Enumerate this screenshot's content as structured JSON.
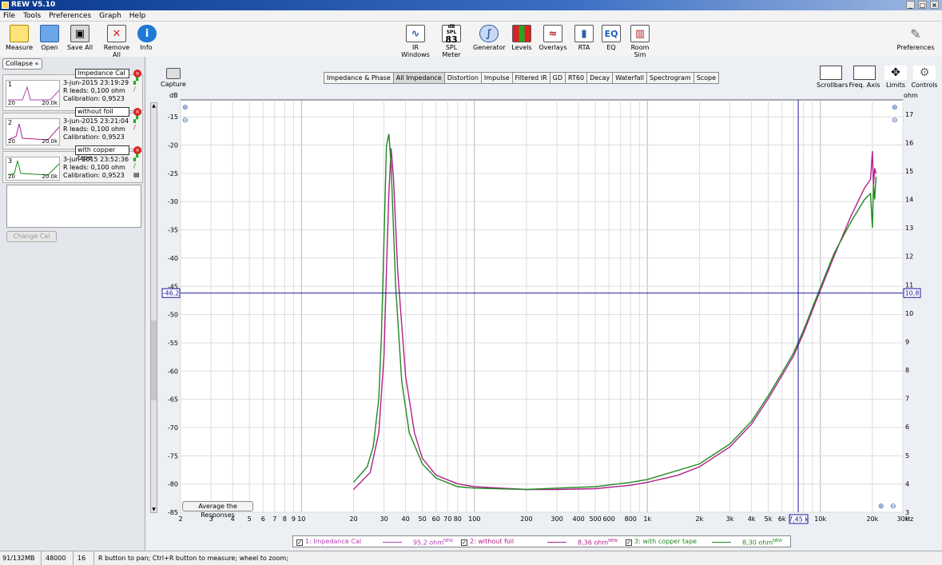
{
  "window": {
    "title": "REW V5.10"
  },
  "menu": [
    "File",
    "Tools",
    "Preferences",
    "Graph",
    "Help"
  ],
  "toolbar": {
    "left": [
      "Measure",
      "Open",
      "Save All",
      "Remove All",
      "Info"
    ],
    "center": [
      "IR Windows",
      "SPL Meter",
      "Generator",
      "Levels",
      "Overlays",
      "RTA",
      "EQ",
      "Room Sim"
    ],
    "spl_meter": {
      "unit": "dB SPL",
      "value": "83"
    },
    "eq_icon_text": "EQ",
    "right": "Preferences"
  },
  "panel": {
    "collapse": "Collapse",
    "measurements": [
      {
        "num": "1",
        "name": "Impedance Cal",
        "date": "3-jun-2015 23:19:29",
        "rleads": "R leads: 0,100 ohm",
        "cal": "Calibration: 0,9523",
        "ax_min": "20",
        "ax_max": "20.0k",
        "color": "#b040b0"
      },
      {
        "num": "2",
        "name": "without foil",
        "date": "3-jun-2015 23:21:04",
        "rleads": "R leads: 0,100 ohm",
        "cal": "Calibration: 0,9523",
        "ax_min": "20",
        "ax_max": "20.0k",
        "color": "#b0208a"
      },
      {
        "num": "3",
        "name": "with copper tape",
        "date": "3-jun-2015 23:52:36",
        "rleads": "R leads: 0,100 ohm",
        "cal": "Calibration: 0,9523",
        "ax_min": "20",
        "ax_max": "20.0k",
        "color": "#208a20"
      }
    ],
    "change_cal": "Change Cal"
  },
  "graph_tools": {
    "capture": "Capture",
    "right": [
      "Scrollbars",
      "Freq. Axis",
      "Limits",
      "Controls"
    ]
  },
  "tabs": [
    "Impedance & Phase",
    "All Impedance",
    "Distortion",
    "Impulse",
    "Filtered IR",
    "GD",
    "RT60",
    "Decay",
    "Waterfall",
    "Spectrogram",
    "Scope"
  ],
  "active_tab": "All Impedance",
  "average_button": "Average the Responses",
  "chart_data": {
    "type": "line",
    "xscale": "log",
    "xlim": [
      2,
      30000
    ],
    "ylim_left": [
      -85,
      -12
    ],
    "ylim_right": [
      3,
      17.5
    ],
    "left_unit": "dB",
    "right_unit": "ohm",
    "x_unit": "Hz",
    "x_ticks": [
      2,
      3,
      4,
      5,
      6,
      7,
      8,
      9,
      10,
      20,
      30,
      40,
      50,
      60,
      70,
      80,
      100,
      200,
      300,
      400,
      500,
      600,
      800,
      1000,
      2000,
      3000,
      4000,
      5000,
      6000,
      7000,
      10000,
      20000,
      30000
    ],
    "x_tick_labels": [
      "2",
      "3",
      "4",
      "5",
      "6",
      "7",
      "8",
      "9",
      "10",
      "20",
      "30",
      "40",
      "50",
      "60",
      "70",
      "80",
      "100",
      "200",
      "300",
      "400",
      "500",
      "600",
      "800",
      "1k",
      "2k",
      "3k",
      "4k",
      "5k",
      "6k",
      "7k",
      "10k",
      "20k",
      "30k"
    ],
    "y_left_ticks": [
      -15,
      -20,
      -25,
      -30,
      -35,
      -40,
      -45,
      -50,
      -55,
      -60,
      -65,
      -70,
      -75,
      -80,
      -85
    ],
    "y_right_ticks": [
      17,
      16,
      15,
      14,
      13,
      12,
      11,
      10,
      9,
      8,
      7,
      6,
      5,
      4,
      3
    ],
    "cursor": {
      "x": 7450,
      "x_label": "7,45 k",
      "y_left": -46.2,
      "y_left_label": "-46,2",
      "y_right_label": "10,8"
    },
    "series": [
      {
        "name": "2: without foil",
        "color": "#b0208a",
        "points": [
          [
            20,
            3.8
          ],
          [
            25,
            4.4
          ],
          [
            28,
            5.8
          ],
          [
            30,
            8.5
          ],
          [
            31,
            11.5
          ],
          [
            32,
            14.2
          ],
          [
            33,
            15.8
          ],
          [
            34,
            14.8
          ],
          [
            36,
            11.5
          ],
          [
            40,
            7.8
          ],
          [
            45,
            5.8
          ],
          [
            50,
            4.9
          ],
          [
            60,
            4.3
          ],
          [
            80,
            4.0
          ],
          [
            100,
            3.9
          ],
          [
            200,
            3.8
          ],
          [
            300,
            3.8
          ],
          [
            500,
            3.83
          ],
          [
            800,
            3.95
          ],
          [
            1000,
            4.05
          ],
          [
            1500,
            4.3
          ],
          [
            2000,
            4.6
          ],
          [
            3000,
            5.3
          ],
          [
            4000,
            6.1
          ],
          [
            5000,
            7.0
          ],
          [
            6000,
            7.8
          ],
          [
            7000,
            8.5
          ],
          [
            8000,
            9.3
          ],
          [
            10000,
            10.8
          ],
          [
            12000,
            12.0
          ],
          [
            15000,
            13.4
          ],
          [
            18000,
            14.4
          ],
          [
            19500,
            14.7
          ],
          [
            20000,
            15.7
          ],
          [
            20300,
            14.5
          ],
          [
            20600,
            15.1
          ],
          [
            21000,
            14.9
          ]
        ]
      },
      {
        "name": "3: with copper tape",
        "color": "#208a20",
        "points": [
          [
            20,
            4.05
          ],
          [
            24,
            4.6
          ],
          [
            26,
            5.3
          ],
          [
            28,
            7.0
          ],
          [
            29,
            9.2
          ],
          [
            30,
            12.6
          ],
          [
            31,
            15.9
          ],
          [
            32,
            16.3
          ],
          [
            33,
            15.2
          ],
          [
            35,
            11.0
          ],
          [
            38,
            7.6
          ],
          [
            42,
            5.8
          ],
          [
            50,
            4.7
          ],
          [
            60,
            4.2
          ],
          [
            80,
            3.9
          ],
          [
            100,
            3.85
          ],
          [
            200,
            3.8
          ],
          [
            300,
            3.85
          ],
          [
            500,
            3.9
          ],
          [
            800,
            4.05
          ],
          [
            1000,
            4.15
          ],
          [
            2000,
            4.7
          ],
          [
            3000,
            5.4
          ],
          [
            4000,
            6.2
          ],
          [
            5000,
            7.1
          ],
          [
            6000,
            7.9
          ],
          [
            7000,
            8.6
          ],
          [
            8000,
            9.4
          ],
          [
            10000,
            10.9
          ],
          [
            12000,
            12.1
          ],
          [
            15000,
            13.2
          ],
          [
            18000,
            14.0
          ],
          [
            19500,
            14.2
          ],
          [
            20000,
            13.0
          ],
          [
            20300,
            14.5
          ],
          [
            20600,
            14.0
          ],
          [
            21000,
            14.8
          ]
        ]
      }
    ]
  },
  "legend": [
    {
      "check": "✓",
      "label": "1: Impedance Cal",
      "value": "95,2 ohm",
      "color": "#b040b0"
    },
    {
      "check": "✓",
      "label": "2: without foil",
      "value": "8,36 ohm",
      "color": "#b0208a"
    },
    {
      "check": "✓",
      "label": "3: with copper tape",
      "value": "8,30 ohm",
      "color": "#208a20"
    }
  ],
  "legend_new": "NEW",
  "status": {
    "memory": "91/132MB",
    "rate": "48000 Hz",
    "bits": "16 Bit",
    "hint": "R button to pan; Ctrl+R button to measure; wheel to zoom;"
  }
}
